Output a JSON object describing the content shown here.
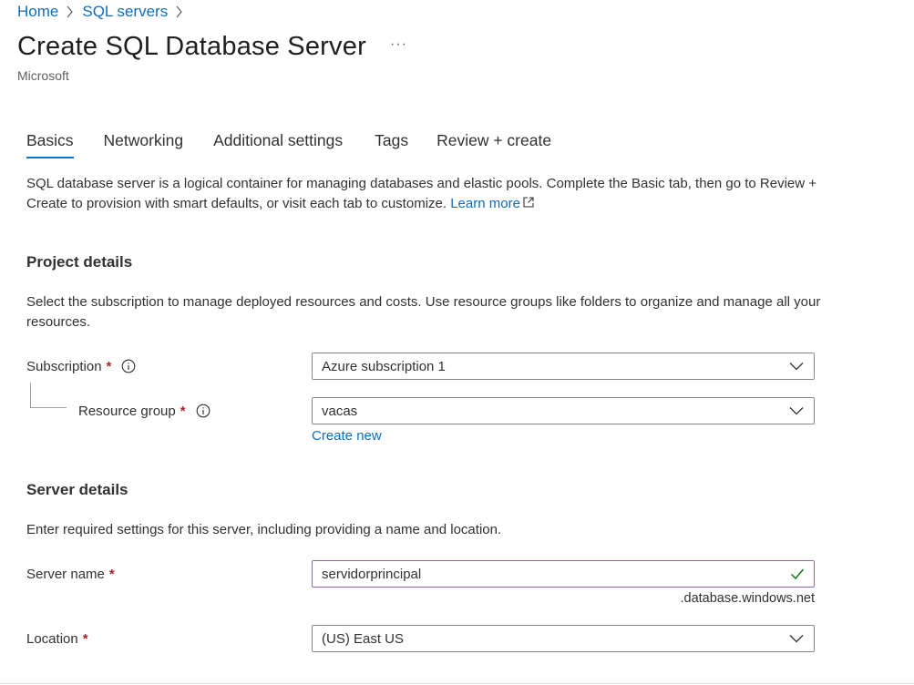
{
  "breadcrumb": {
    "items": [
      "Home",
      "SQL servers"
    ]
  },
  "page": {
    "title": "Create SQL Database Server",
    "more_label": "···",
    "publisher": "Microsoft"
  },
  "tabs": [
    {
      "label": "Basics",
      "active": true
    },
    {
      "label": "Networking",
      "active": false
    },
    {
      "label": "Additional settings",
      "active": false
    },
    {
      "label": "Tags",
      "active": false
    },
    {
      "label": "Review + create",
      "active": false
    }
  ],
  "intro": {
    "text": "SQL database server is a logical container for managing databases and elastic pools. Complete the Basic tab, then go to Review + Create to provision with smart defaults, or visit each tab to customize.",
    "learn_more": "Learn more"
  },
  "project_details": {
    "title": "Project details",
    "description": "Select the subscription to manage deployed resources and costs. Use resource groups like folders to organize and manage all your resources.",
    "subscription": {
      "label": "Subscription",
      "required_mark": "*",
      "value": "Azure subscription 1"
    },
    "resource_group": {
      "label": "Resource group",
      "required_mark": "*",
      "value": "vacas",
      "create_new": "Create new"
    }
  },
  "server_details": {
    "title": "Server details",
    "description": "Enter required settings for this server, including providing a name and location.",
    "server_name": {
      "label": "Server name",
      "required_mark": "*",
      "value": "servidorprincipal",
      "suffix": ".database.windows.net"
    },
    "location": {
      "label": "Location",
      "required_mark": "*",
      "value": "(US) East US"
    }
  },
  "colors": {
    "accent": "#0078d4",
    "link": "#0f6cbd",
    "required": "#a4262c",
    "valid": "#107c10"
  }
}
